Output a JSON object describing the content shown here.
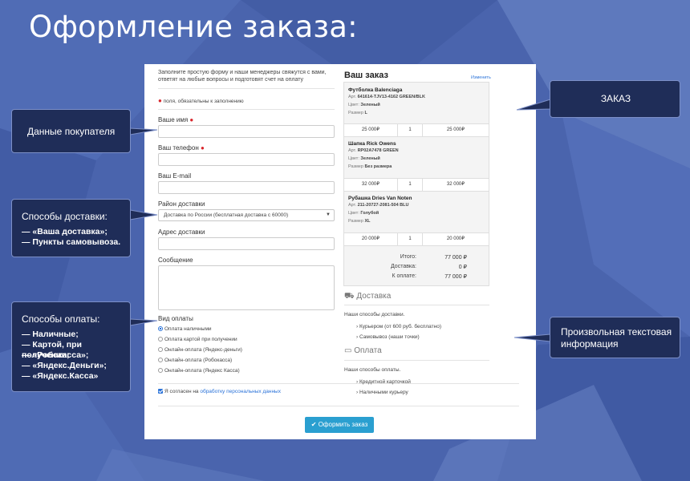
{
  "title": "Оформление заказа:",
  "form": {
    "intro": "Заполните простую форму и наши менеджеры свяжутся с вами, ответят на любые вопросы и подготовят счет на оплату",
    "required_note": "поля, обязательны к заполнению",
    "name_label": "Ваше имя",
    "phone_label": "Ваш телефон",
    "email_label": "Ваш E-mail",
    "region_label": "Район доставки",
    "region_value": "Доставка по России (бесплатная доставка с 60000)",
    "address_label": "Адрес доставки",
    "message_label": "Сообщение",
    "payment_label": "Вид оплаты",
    "payment_options": [
      "Оплата наличными",
      "Оплата картой при получении",
      "Онлайн-оплата (Яндекс-деньги)",
      "Онлайн-оплата (Робокасса)",
      "Онлайн-оплата (Яндекс Касса)"
    ],
    "consent_prefix": "Я согласен на",
    "consent_link": "обработку персональных данных",
    "submit_label": "Оформить заказ"
  },
  "order": {
    "title": "Ваш заказ",
    "edit_link": "Изменить",
    "items": [
      {
        "name": "Футболка Balenciaga",
        "art_label": "Арт.",
        "art": "641614-TJV13-4162 GREEN/BLK",
        "color_label": "Цвет:",
        "color": "Зеленый",
        "size_label": "Размер",
        "size": "L",
        "price": "25 000₽",
        "qty": "1",
        "sum": "25 000₽"
      },
      {
        "name": "Шапка Rick Owens",
        "art_label": "Арт.",
        "art": "RP02A7478 GREEN",
        "color_label": "Цвет:",
        "color": "Зеленый",
        "size_label": "Размер",
        "size": "Без размера",
        "price": "32 000₽",
        "qty": "1",
        "sum": "32 000₽"
      },
      {
        "name": "Рубашка Dries Van Noten",
        "art_label": "Арт.",
        "art": "211-20727-2081-504 BLU",
        "color_label": "Цвет:",
        "color": "Голубой",
        "size_label": "Размер",
        "size": "XL",
        "price": "20 000₽",
        "qty": "1",
        "sum": "20 000₽"
      }
    ],
    "totals": [
      {
        "label": "Итого:",
        "value": "77 000 ₽"
      },
      {
        "label": "Доставка:",
        "value": "0 ₽"
      },
      {
        "label": "К оплате:",
        "value": "77 000 ₽"
      }
    ]
  },
  "delivery": {
    "title": "Доставка",
    "intro": "Наши способы доставки.",
    "items": [
      "Курьером (от 600 руб. бесплатно)",
      "Самовывоз (наши точки)"
    ]
  },
  "payment": {
    "title": "Оплата",
    "intro": "Наши способы оплаты.",
    "items": [
      "Кредитной карточкой",
      "Наличными курьеру"
    ]
  },
  "callouts": {
    "buyer": "Данные покупателя",
    "delivery_title": "Способы доставки:",
    "delivery_lines": [
      "— «Ваша доставка»;",
      "— Пункты самовывоза."
    ],
    "payment_title": "Способы оплаты:",
    "payment_lines": [
      "— Наличные;",
      "— Картой, при получении;",
      "— «Робокасса»;",
      "— «Яндекс.Деньги»;",
      "— «Яндекс.Касса»"
    ],
    "order": "ЗАКАЗ",
    "info": "Произвольная текстовая информация"
  },
  "colors": {
    "bg": "#4a64ad",
    "callout": "#1f2d58",
    "accent": "#2b73d9",
    "button": "#2a9fd0",
    "required": "#d9262c"
  }
}
